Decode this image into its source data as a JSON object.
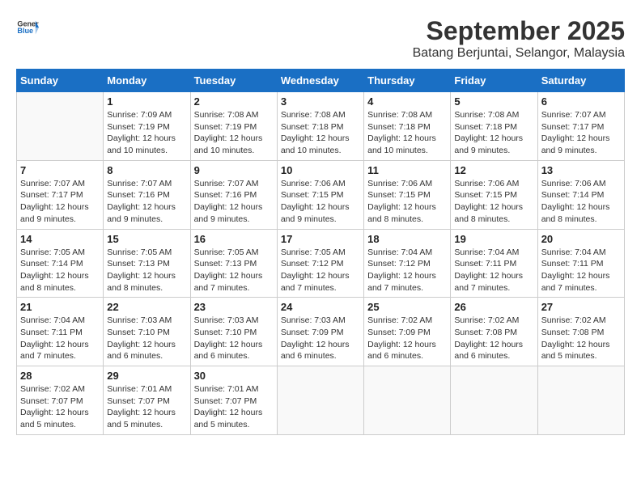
{
  "header": {
    "logo_general": "General",
    "logo_blue": "Blue",
    "month": "September 2025",
    "location": "Batang Berjuntai, Selangor, Malaysia"
  },
  "weekdays": [
    "Sunday",
    "Monday",
    "Tuesday",
    "Wednesday",
    "Thursday",
    "Friday",
    "Saturday"
  ],
  "weeks": [
    [
      {
        "day": "",
        "info": ""
      },
      {
        "day": "1",
        "info": "Sunrise: 7:09 AM\nSunset: 7:19 PM\nDaylight: 12 hours\nand 10 minutes."
      },
      {
        "day": "2",
        "info": "Sunrise: 7:08 AM\nSunset: 7:19 PM\nDaylight: 12 hours\nand 10 minutes."
      },
      {
        "day": "3",
        "info": "Sunrise: 7:08 AM\nSunset: 7:18 PM\nDaylight: 12 hours\nand 10 minutes."
      },
      {
        "day": "4",
        "info": "Sunrise: 7:08 AM\nSunset: 7:18 PM\nDaylight: 12 hours\nand 10 minutes."
      },
      {
        "day": "5",
        "info": "Sunrise: 7:08 AM\nSunset: 7:18 PM\nDaylight: 12 hours\nand 9 minutes."
      },
      {
        "day": "6",
        "info": "Sunrise: 7:07 AM\nSunset: 7:17 PM\nDaylight: 12 hours\nand 9 minutes."
      }
    ],
    [
      {
        "day": "7",
        "info": "Sunrise: 7:07 AM\nSunset: 7:17 PM\nDaylight: 12 hours\nand 9 minutes."
      },
      {
        "day": "8",
        "info": "Sunrise: 7:07 AM\nSunset: 7:16 PM\nDaylight: 12 hours\nand 9 minutes."
      },
      {
        "day": "9",
        "info": "Sunrise: 7:07 AM\nSunset: 7:16 PM\nDaylight: 12 hours\nand 9 minutes."
      },
      {
        "day": "10",
        "info": "Sunrise: 7:06 AM\nSunset: 7:15 PM\nDaylight: 12 hours\nand 9 minutes."
      },
      {
        "day": "11",
        "info": "Sunrise: 7:06 AM\nSunset: 7:15 PM\nDaylight: 12 hours\nand 8 minutes."
      },
      {
        "day": "12",
        "info": "Sunrise: 7:06 AM\nSunset: 7:15 PM\nDaylight: 12 hours\nand 8 minutes."
      },
      {
        "day": "13",
        "info": "Sunrise: 7:06 AM\nSunset: 7:14 PM\nDaylight: 12 hours\nand 8 minutes."
      }
    ],
    [
      {
        "day": "14",
        "info": "Sunrise: 7:05 AM\nSunset: 7:14 PM\nDaylight: 12 hours\nand 8 minutes."
      },
      {
        "day": "15",
        "info": "Sunrise: 7:05 AM\nSunset: 7:13 PM\nDaylight: 12 hours\nand 8 minutes."
      },
      {
        "day": "16",
        "info": "Sunrise: 7:05 AM\nSunset: 7:13 PM\nDaylight: 12 hours\nand 7 minutes."
      },
      {
        "day": "17",
        "info": "Sunrise: 7:05 AM\nSunset: 7:12 PM\nDaylight: 12 hours\nand 7 minutes."
      },
      {
        "day": "18",
        "info": "Sunrise: 7:04 AM\nSunset: 7:12 PM\nDaylight: 12 hours\nand 7 minutes."
      },
      {
        "day": "19",
        "info": "Sunrise: 7:04 AM\nSunset: 7:11 PM\nDaylight: 12 hours\nand 7 minutes."
      },
      {
        "day": "20",
        "info": "Sunrise: 7:04 AM\nSunset: 7:11 PM\nDaylight: 12 hours\nand 7 minutes."
      }
    ],
    [
      {
        "day": "21",
        "info": "Sunrise: 7:04 AM\nSunset: 7:11 PM\nDaylight: 12 hours\nand 7 minutes."
      },
      {
        "day": "22",
        "info": "Sunrise: 7:03 AM\nSunset: 7:10 PM\nDaylight: 12 hours\nand 6 minutes."
      },
      {
        "day": "23",
        "info": "Sunrise: 7:03 AM\nSunset: 7:10 PM\nDaylight: 12 hours\nand 6 minutes."
      },
      {
        "day": "24",
        "info": "Sunrise: 7:03 AM\nSunset: 7:09 PM\nDaylight: 12 hours\nand 6 minutes."
      },
      {
        "day": "25",
        "info": "Sunrise: 7:02 AM\nSunset: 7:09 PM\nDaylight: 12 hours\nand 6 minutes."
      },
      {
        "day": "26",
        "info": "Sunrise: 7:02 AM\nSunset: 7:08 PM\nDaylight: 12 hours\nand 6 minutes."
      },
      {
        "day": "27",
        "info": "Sunrise: 7:02 AM\nSunset: 7:08 PM\nDaylight: 12 hours\nand 5 minutes."
      }
    ],
    [
      {
        "day": "28",
        "info": "Sunrise: 7:02 AM\nSunset: 7:07 PM\nDaylight: 12 hours\nand 5 minutes."
      },
      {
        "day": "29",
        "info": "Sunrise: 7:01 AM\nSunset: 7:07 PM\nDaylight: 12 hours\nand 5 minutes."
      },
      {
        "day": "30",
        "info": "Sunrise: 7:01 AM\nSunset: 7:07 PM\nDaylight: 12 hours\nand 5 minutes."
      },
      {
        "day": "",
        "info": ""
      },
      {
        "day": "",
        "info": ""
      },
      {
        "day": "",
        "info": ""
      },
      {
        "day": "",
        "info": ""
      }
    ]
  ]
}
